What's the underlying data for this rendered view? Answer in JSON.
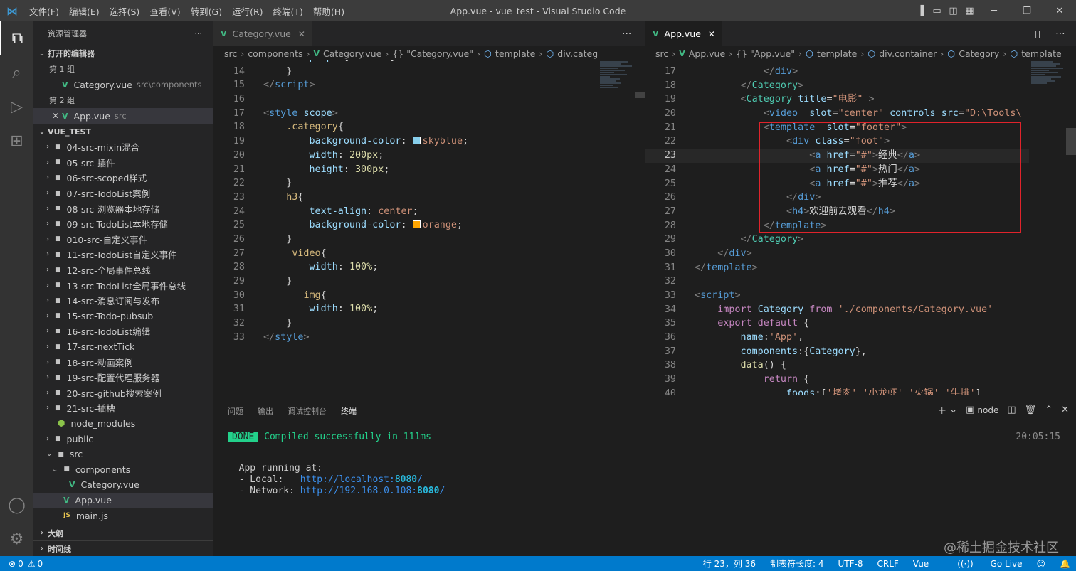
{
  "window": {
    "title": "App.vue - vue_test - Visual Studio Code",
    "menu": [
      "文件(F)",
      "编辑(E)",
      "选择(S)",
      "查看(V)",
      "转到(G)",
      "运行(R)",
      "终端(T)",
      "帮助(H)"
    ]
  },
  "sidebar": {
    "header": "资源管理器",
    "open_editors_label": "打开的编辑器",
    "group1_label": "第 1 组",
    "group1_file": "Category.vue",
    "group1_path": "src\\components",
    "group2_label": "第 2 组",
    "group2_file": "App.vue",
    "group2_path": "src",
    "project_label": "VUE_TEST",
    "tree": [
      {
        "label": "04-src-mixin混合",
        "depth": 1,
        "kind": "folder-closed"
      },
      {
        "label": "05-src-插件",
        "depth": 1,
        "kind": "folder-closed"
      },
      {
        "label": "06-src-scoped样式",
        "depth": 1,
        "kind": "folder-closed"
      },
      {
        "label": "07-src-TodoList案例",
        "depth": 1,
        "kind": "folder-closed"
      },
      {
        "label": "08-src-浏览器本地存储",
        "depth": 1,
        "kind": "folder-closed"
      },
      {
        "label": "09-src-TodoList本地存储",
        "depth": 1,
        "kind": "folder-closed"
      },
      {
        "label": "010-src-自定义事件",
        "depth": 1,
        "kind": "folder-closed"
      },
      {
        "label": "11-src-TodoList自定义事件",
        "depth": 1,
        "kind": "folder-closed"
      },
      {
        "label": "12-src-全局事件总线",
        "depth": 1,
        "kind": "folder-closed"
      },
      {
        "label": "13-src-TodoList全局事件总线",
        "depth": 1,
        "kind": "folder-closed"
      },
      {
        "label": "14-src-消息订阅与发布",
        "depth": 1,
        "kind": "folder-closed"
      },
      {
        "label": "15-src-Todo-pubsub",
        "depth": 1,
        "kind": "folder-closed"
      },
      {
        "label": "16-src-TodoList编辑",
        "depth": 1,
        "kind": "folder-closed"
      },
      {
        "label": "17-src-nextTick",
        "depth": 1,
        "kind": "folder-closed"
      },
      {
        "label": "18-src-动画案例",
        "depth": 1,
        "kind": "folder-closed"
      },
      {
        "label": "19-src-配置代理服务器",
        "depth": 1,
        "kind": "folder-closed"
      },
      {
        "label": "20-src-github搜索案例",
        "depth": 1,
        "kind": "folder-closed"
      },
      {
        "label": "21-src-插槽",
        "depth": 1,
        "kind": "folder-closed"
      },
      {
        "label": "node_modules",
        "depth": 1,
        "kind": "nm"
      },
      {
        "label": "public",
        "depth": 1,
        "kind": "folder-closed"
      },
      {
        "label": "src",
        "depth": 1,
        "kind": "folder-open"
      },
      {
        "label": "components",
        "depth": 2,
        "kind": "folder-open"
      },
      {
        "label": "Category.vue",
        "depth": 3,
        "kind": "vue"
      },
      {
        "label": "App.vue",
        "depth": 2,
        "kind": "vue",
        "selected": true
      },
      {
        "label": "main.js",
        "depth": 2,
        "kind": "js"
      }
    ],
    "outline_label": "大纲",
    "timeline_label": "时间线"
  },
  "editor_left": {
    "tab": "Category.vue",
    "breadcrumbs": [
      "src",
      "components",
      "Category.vue",
      "{} \"Category.vue\"",
      "template",
      "div.category"
    ]
  },
  "editor_right": {
    "tab": "App.vue",
    "breadcrumbs": [
      "src",
      "App.vue",
      "{} \"App.vue\"",
      "template",
      "div.container",
      "Category",
      "template"
    ]
  },
  "panel": {
    "tabs": [
      "问题",
      "输出",
      "调试控制台",
      "终端"
    ],
    "active_tab": "终端",
    "terminal_name": "node",
    "done_badge": "DONE",
    "compiled": "Compiled successfully in 111ms",
    "time": "20:05:15",
    "running": "App running at:",
    "local_label": "- Local:   ",
    "local_url": "http://localhost:",
    "local_port": "8080",
    "network_label": "- Network: ",
    "network_url": "http://192.168.0.108:",
    "network_port": "8080",
    "slash": "/"
  },
  "statusbar": {
    "errors": "0",
    "warnings": "0",
    "position": "行 23，列 36",
    "tab_size": "制表符长度: 4",
    "encoding": "UTF-8",
    "eol": "CRLF",
    "language": "Vue",
    "golive": "Go Live"
  },
  "watermark": "@稀土掘金技术社区",
  "colors": {
    "accent": "#007acc",
    "highlight_box": "#e0232b",
    "done_badge": "#23d18b"
  }
}
